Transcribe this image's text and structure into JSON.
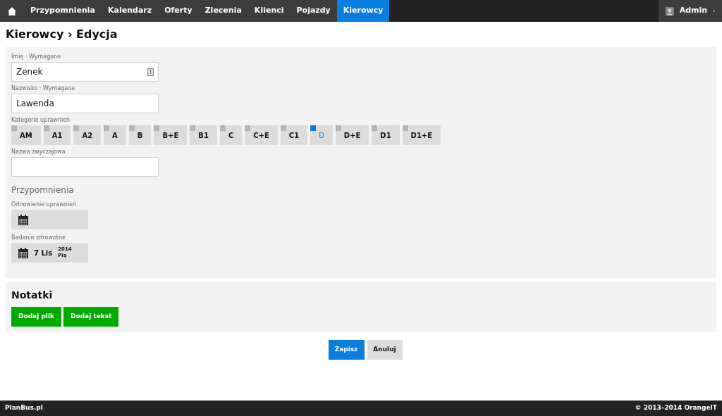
{
  "nav": {
    "items": [
      {
        "label": "Przypomnienia",
        "selected": false
      },
      {
        "label": "Kalendarz",
        "selected": false
      },
      {
        "label": "Oferty",
        "selected": false
      },
      {
        "label": "Zlecenia",
        "selected": false
      },
      {
        "label": "Klienci",
        "selected": false
      },
      {
        "label": "Pojazdy",
        "selected": false
      },
      {
        "label": "Kierowcy",
        "selected": true
      }
    ],
    "user": "Admin"
  },
  "title": "Kierowcy › Edycja",
  "form": {
    "first_name": {
      "label": "Imię · Wymagane",
      "value": "Zenek"
    },
    "last_name": {
      "label": "Nazwisko · Wymagane",
      "value": "Lawenda"
    },
    "categories_label": "Kategorie uprawnień",
    "categories": [
      {
        "label": "AM",
        "checked": false
      },
      {
        "label": "A1",
        "checked": false
      },
      {
        "label": "A2",
        "checked": false
      },
      {
        "label": "A",
        "checked": false
      },
      {
        "label": "B",
        "checked": false
      },
      {
        "label": "B+E",
        "checked": false
      },
      {
        "label": "B1",
        "checked": false
      },
      {
        "label": "C",
        "checked": false
      },
      {
        "label": "C+E",
        "checked": false
      },
      {
        "label": "C1",
        "checked": false
      },
      {
        "label": "D",
        "checked": true
      },
      {
        "label": "D+E",
        "checked": false
      },
      {
        "label": "D1",
        "checked": false
      },
      {
        "label": "D1+E",
        "checked": false
      }
    ],
    "nickname": {
      "label": "Nazwa zwyczajowa"
    },
    "reminders_title": "Przypomnienia",
    "reminders": [
      {
        "label": "Odnowienie uprawnień"
      },
      {
        "label": "Badanie zdrowotne",
        "day": "7 Lis",
        "year": "2014",
        "weekday": "Pią"
      }
    ]
  },
  "notes": {
    "title": "Notatki",
    "buttons": [
      "Dodaj plik",
      "Dodaj tekst"
    ]
  },
  "actions": {
    "save": "Zapisz",
    "cancel": "Anuluj"
  },
  "footer": {
    "left": "PlanBus.pl",
    "right": "© 2013–2014 OrangeIT"
  }
}
